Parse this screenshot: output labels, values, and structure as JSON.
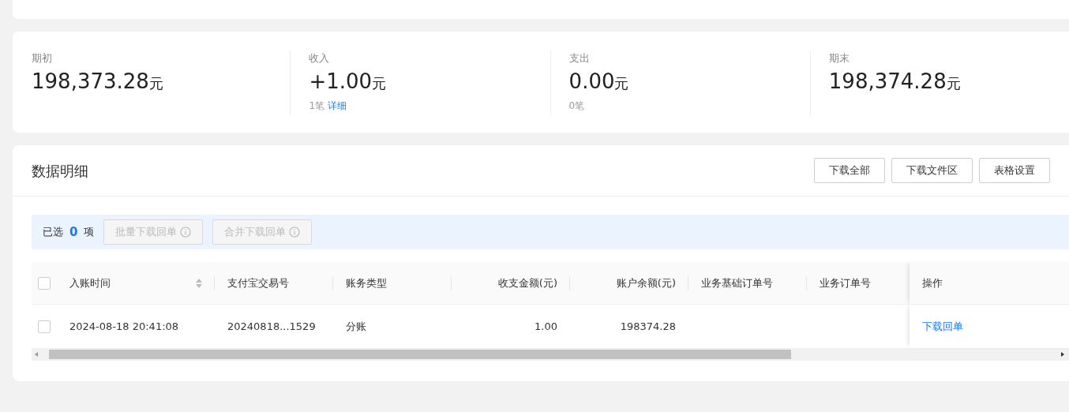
{
  "stats": [
    {
      "label": "期初",
      "amount": "198,373.28",
      "unit": "元"
    },
    {
      "label": "收入",
      "amount": "+1.00",
      "unit": "元",
      "count": "1笔",
      "link": "详细"
    },
    {
      "label": "支出",
      "amount": "0.00",
      "unit": "元",
      "count": "0笔"
    },
    {
      "label": "期末",
      "amount": "198,374.28",
      "unit": "元"
    }
  ],
  "detail": {
    "title": "数据明细",
    "buttons": [
      "下载全部",
      "下载文件区",
      "表格设置"
    ],
    "selection": {
      "prefix": "已选",
      "count": "0",
      "suffix": "项"
    },
    "batch_buttons": [
      {
        "label": "批量下载回单",
        "disabled": true
      },
      {
        "label": "合并下载回单",
        "disabled": true
      }
    ],
    "table": {
      "select_all_checked": false,
      "columns": [
        {
          "label": "入账时间",
          "kind": "text",
          "sortable": true
        },
        {
          "label": "支付宝交易号",
          "kind": "text",
          "sortable": false
        },
        {
          "label": "账务类型",
          "kind": "text",
          "sortable": false
        },
        {
          "label": "收支金额(元)",
          "kind": "amount",
          "sortable": false
        },
        {
          "label": "账户余额(元)",
          "kind": "amount",
          "sortable": false
        },
        {
          "label": "业务基础订单号",
          "kind": "text",
          "sortable": false
        },
        {
          "label": "业务订单号",
          "kind": "text",
          "sortable": false
        },
        {
          "label": "操作",
          "kind": "text",
          "sortable": false
        }
      ],
      "rows": [
        {
          "checked": false,
          "cells": [
            "2024-08-18 20:41:08",
            "20240818...1529",
            "分账",
            "1.00",
            "198374.28",
            "",
            ""
          ],
          "action": "下载回单"
        }
      ]
    }
  }
}
